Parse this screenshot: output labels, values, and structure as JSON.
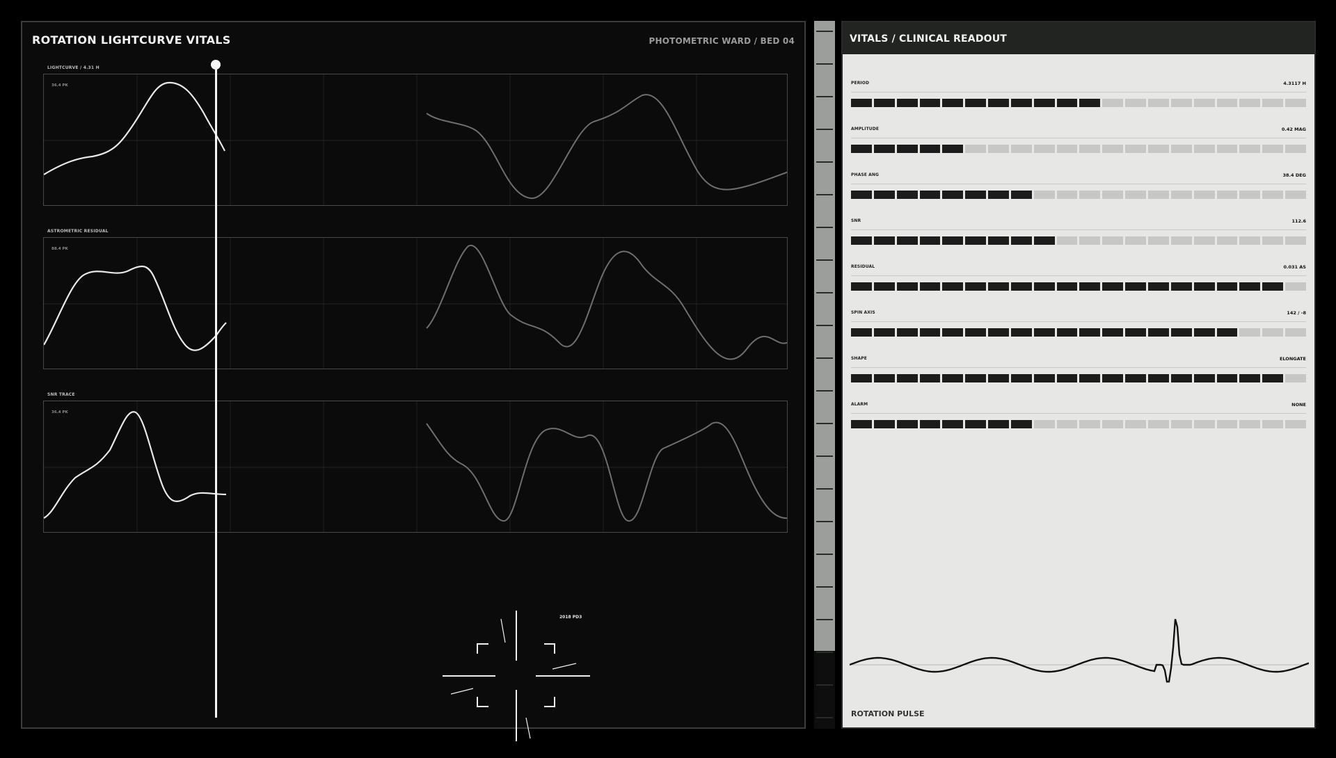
{
  "left_panel": {
    "title": "ROTATION LIGHTCURVE VITALS",
    "subtitle": "PHOTOMETRIC WARD / BED 04",
    "plots": [
      {
        "label": "LIGHTCURVE / 4.31 H",
        "pk": "36.4 PK"
      },
      {
        "label": "ASTROMETRIC RESIDUAL",
        "pk": "88.4 PK"
      },
      {
        "label": "SNR TRACE",
        "pk": "36.4 PK"
      }
    ],
    "target_label": "2018 PD3"
  },
  "right_panel": {
    "title": "VITALS / CLINICAL READOUT",
    "vitals": [
      {
        "label": "PERIOD",
        "value": "4.3117 H",
        "level": 0.55
      },
      {
        "label": "AMPLITUDE",
        "value": "0.42 MAG",
        "level": 0.25
      },
      {
        "label": "PHASE ANG",
        "value": "38.4 DEG",
        "level": 0.4
      },
      {
        "label": "SNR",
        "value": "112.6",
        "level": 0.45
      },
      {
        "label": "RESIDUAL",
        "value": "0.031 AS",
        "level": 0.95
      },
      {
        "label": "SPIN AXIS",
        "value": "142 / -8",
        "level": 0.85
      },
      {
        "label": "SHAPE",
        "value": "ELONGATE",
        "level": 0.95
      },
      {
        "label": "ALARM",
        "value": "NONE",
        "level": 0.4
      }
    ],
    "pulse_label": "ROTATION PULSE"
  },
  "colors": {
    "background": "#000000",
    "panel_dark": "#0a0b0a",
    "panel_light": "#e7e8e5",
    "trace_bright": "#e8e8e8",
    "trace_dim": "#6e6e6e",
    "bar_on": "#1b1c1b",
    "bar_off": "#c7c8c5"
  },
  "icons": [
    "target-reticle-icon",
    "scrubber-handle-icon"
  ]
}
